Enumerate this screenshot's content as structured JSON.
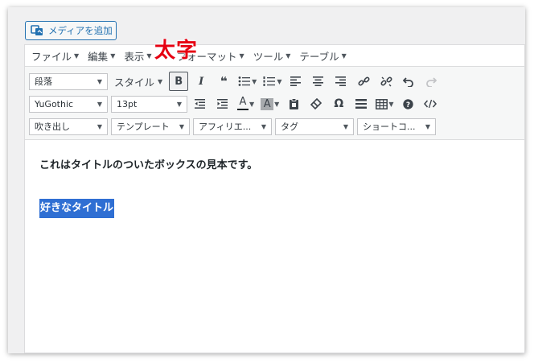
{
  "media_button": {
    "label": "メディアを追加",
    "icon": "media-icon"
  },
  "menubar": {
    "items": [
      {
        "label": "ファイル"
      },
      {
        "label": "編集"
      },
      {
        "label": "表示"
      },
      {
        "label": "フォーマット"
      },
      {
        "label": "ツール"
      },
      {
        "label": "テーブル"
      }
    ]
  },
  "annotation": {
    "text": "太字",
    "color": "#e60012"
  },
  "toolbar": {
    "row1": {
      "paragraph_format": "段落",
      "style_label": "スタイル",
      "bold": "B",
      "italic": "I",
      "blockquote": "❝"
    },
    "row2": {
      "font_family": "YuGothic",
      "font_size": "13pt",
      "omega": "Ω"
    },
    "row3": {
      "balloon": "吹き出し",
      "template": "テンプレート",
      "affiliate": "アフィリエ...",
      "tag": "タグ",
      "shortcode": "ショートコ..."
    }
  },
  "content": {
    "paragraph": "これはタイトルのついたボックスの見本です。",
    "selected_title": "好きなタイトル"
  },
  "colors": {
    "accent": "#2271b1",
    "selection": "#2f6fd3"
  }
}
